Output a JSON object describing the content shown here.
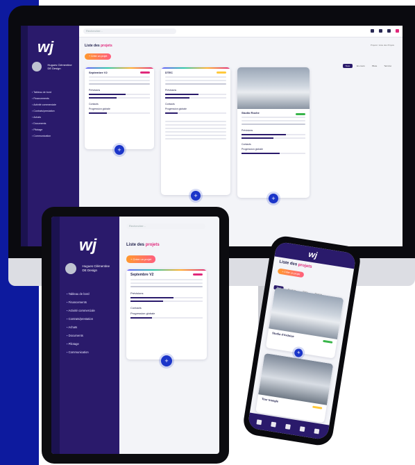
{
  "brand": {
    "logo_text": "wj",
    "user_name": "Hugues Clémentine",
    "user_role": "DE Design"
  },
  "search": {
    "placeholder": "Rechercher..."
  },
  "page": {
    "title_prefix": "Liste des",
    "title_highlight": "projets",
    "new_button": "+ Créer un projet"
  },
  "breadcrumb": "Projets  /  Liste des Projets",
  "filters": [
    "Tous",
    "En cours",
    "Pilote",
    "Terminé"
  ],
  "menu": [
    "Tableau de bord",
    "Financements",
    "Activité commerciale",
    "Contrats/prestation",
    "Achats",
    "Documents",
    "Pilotage",
    "Communication"
  ],
  "cards": [
    {
      "title": "Septembre V2",
      "tag_color": "#e0287b",
      "progress": 0.3,
      "add_label": "+"
    },
    {
      "title": "DTEC",
      "tag_color": "#ffc93c",
      "progress": 0.2,
      "add_label": "+"
    },
    {
      "title": "Studio Roche",
      "tag_color": "#39b54a",
      "progress": 0.6,
      "add_label": "+"
    }
  ],
  "sections": {
    "previsions": "Prévisions",
    "contacts": "Contacts",
    "progression": "Progression globale"
  },
  "phone": {
    "card1_title": "Studio d'Ardoise",
    "card2_title": "Tour triangle"
  },
  "colors": {
    "sidebar": "#2a1a6b",
    "accent": "#e0287b",
    "primary": "#1b35c9",
    "brand_blue": "#0d1a9e"
  }
}
